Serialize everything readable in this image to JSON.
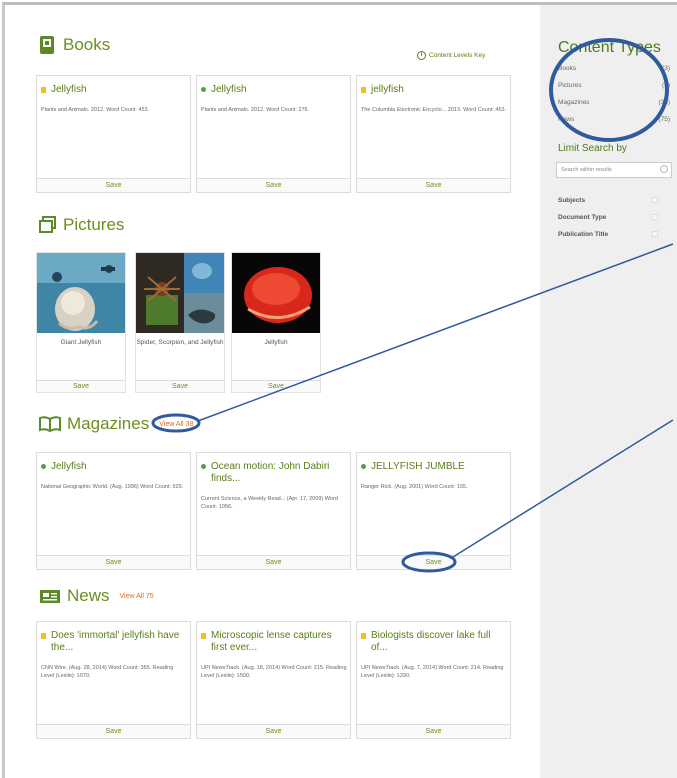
{
  "key_link": {
    "label": "Content Levels Key",
    "icon": "info-icon"
  },
  "books": {
    "title": "Books",
    "icon": "book-icon",
    "cards": [
      {
        "title": "Jellyfish",
        "meta": "Plants and Animals. 2012. Word Count: 453.",
        "save": "Save",
        "bullet": "square",
        "bullet_color": "#f0c020"
      },
      {
        "title": "Jellyfish",
        "meta": "Plants and Animals. 2012. Word Count: 276.",
        "save": "Save",
        "bullet": "dot",
        "bullet_color": "#4aa640"
      },
      {
        "title": "jellyfish",
        "meta": "The Columbia Electronic Encyclo... 2013. Word Count: 453.",
        "save": "Save",
        "bullet": "square",
        "bullet_color": "#f0c020"
      }
    ]
  },
  "pictures": {
    "title": "Pictures",
    "icon": "pictures-icon",
    "cards": [
      {
        "caption": "Giant Jellyfish",
        "save": "Save"
      },
      {
        "caption": "Spider, Scorpion, and Jellyfish",
        "save": "Save"
      },
      {
        "caption": "Jellyfish",
        "save": "Save"
      }
    ]
  },
  "magazines": {
    "title": "Magazines",
    "view_all": "View All 38",
    "icon": "open-book-icon",
    "cards": [
      {
        "title": "Jellyfish",
        "meta": "National Geographic World. (Aug. 1996) Word Count: 929.",
        "save": "Save",
        "bullet": "dot"
      },
      {
        "title": "Ocean motion: John Dabiri finds...",
        "meta": "Current Science, a Weekly Read... (Apr. 17, 2009) Word Count: 1056.",
        "save": "Save",
        "bullet": "dot"
      },
      {
        "title": "JELLYFISH JUMBLE",
        "meta": "Ranger Rick. (Aug. 2001) Word Count: 165.",
        "save": "Save",
        "bullet": "dot"
      }
    ]
  },
  "news": {
    "title": "News",
    "view_all": "View All 75",
    "icon": "newspaper-icon",
    "cards": [
      {
        "title": "Does 'immortal' jellyfish have the...",
        "meta": "CNN Wire. (Aug. 28, 2014) Word Count: 365. Reading Level (Lexile): 1070.",
        "save": "Save",
        "bullet": "square"
      },
      {
        "title": "Microscopic lense captures first ever...",
        "meta": "UPI NewsTrack. (Aug. 18, 2014) Word Count: 215. Reading Level (Lexile): 1500.",
        "save": "Save",
        "bullet": "square"
      },
      {
        "title": "Biologists discover lake full of...",
        "meta": "UPI NewsTrack. (Aug. 7, 2014) Word Count: 214. Reading Level (Lexile): 1290.",
        "save": "Save",
        "bullet": "square"
      }
    ]
  },
  "sidebar": {
    "content_types_title": "Content Types",
    "types": [
      {
        "label": "Books",
        "count": "(3)"
      },
      {
        "label": "Pictures",
        "count": "(3)"
      },
      {
        "label": "Magazines",
        "count": "(38)"
      },
      {
        "label": "News",
        "count": "(75)"
      }
    ],
    "limit_title": "Limit Search by",
    "search_placeholder": "Search within results",
    "facets": [
      {
        "label": "Subjects"
      },
      {
        "label": "Document Type"
      },
      {
        "label": "Publication Title"
      }
    ]
  },
  "colors": {
    "accent": "#6b8f1e",
    "highlight_ellipse": "#2f5a9e",
    "view_all": "#e06a1a"
  }
}
